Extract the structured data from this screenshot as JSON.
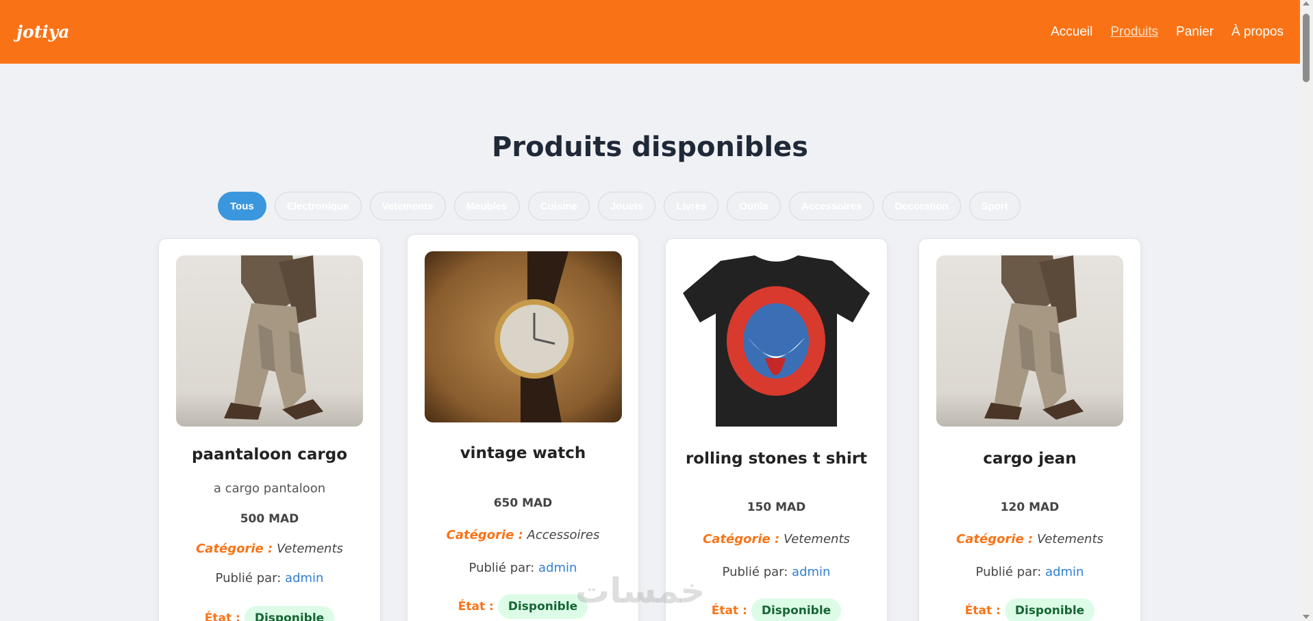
{
  "header": {
    "logo": "jotiya",
    "nav": [
      "Accueil",
      "Produits",
      "Panier",
      "À propos"
    ],
    "active_nav": "Produits",
    "bg_color": "#f97316"
  },
  "page_title": "Produits disponibles",
  "filters": [
    "Tous",
    "Electronique",
    "Vetements",
    "Meubles",
    "Cuisine",
    "Jouets",
    "Livres",
    "Outils",
    "Accessoires",
    "Decoration",
    "Sport"
  ],
  "active_filter": "Tous",
  "labels": {
    "category": "Catégorie :",
    "published_by": "Publié par:",
    "state": "État :"
  },
  "products": [
    {
      "name": "paantaloon cargo",
      "description": "a cargo pantaloon",
      "price": "500 MAD",
      "category": "Vetements",
      "user": "admin",
      "status": "Disponible",
      "image": "cargo-pants-photo"
    },
    {
      "name": "vintage watch",
      "description": "",
      "price": "650 MAD",
      "category": "Accessoires",
      "user": "admin",
      "status": "Disponible",
      "image": "vintage-watch-photo"
    },
    {
      "name": "rolling stones t shirt",
      "description": "",
      "price": "150 MAD",
      "category": "Vetements",
      "user": "admin",
      "status": "Disponible",
      "image": "tshirt-photo"
    },
    {
      "name": "cargo jean",
      "description": "",
      "price": "120 MAD",
      "category": "Vetements",
      "user": "admin",
      "status": "Disponible",
      "image": "cargo-pants-photo"
    }
  ],
  "watermark": "خمسات"
}
